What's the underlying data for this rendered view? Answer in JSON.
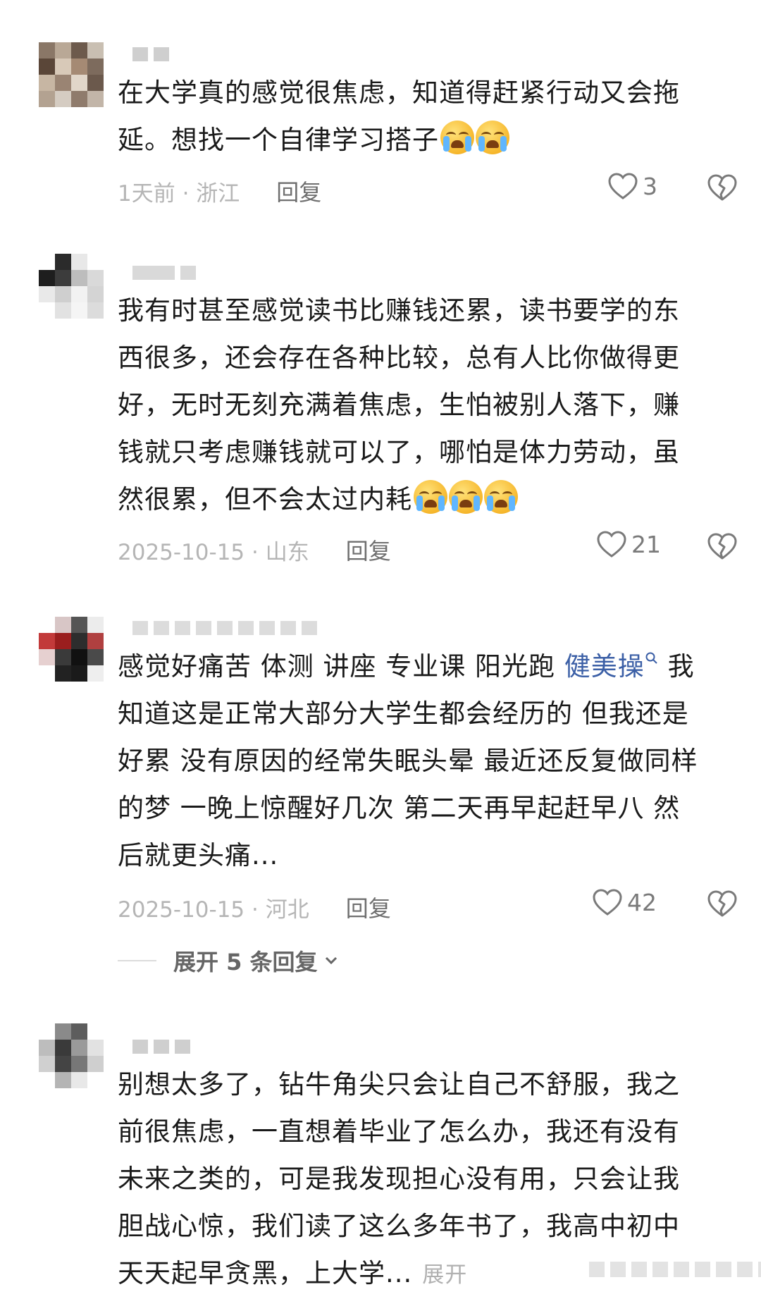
{
  "comments": [
    {
      "text_lines": [
        "在大学真的感觉很焦虑，知道得赶紧行动又会拖",
        "延。想找一个自律学习搭子"
      ],
      "emoji_count": 2,
      "time_location": "1天前 · 浙江",
      "reply_label": "回复",
      "likes": "3"
    },
    {
      "text_lines": [
        "我有时甚至感觉读书比赚钱还累，读书要学的东",
        "西很多，还会存在各种比较，总有人比你做得更",
        "好，无时无刻充满着焦虑，生怕被别人落下，赚",
        "钱就只考虑赚钱就可以了，哪怕是体力劳动，虽",
        "然很累，但不会太过内耗"
      ],
      "emoji_count": 3,
      "time_location": "2025-10-15 · 山东",
      "reply_label": "回复",
      "likes": "21"
    },
    {
      "text_line1_prefix": "感觉好痛苦 体测 讲座 专业课 阳光跑 ",
      "text_line1_link": "健美操",
      "text_line1_suffix": " 我",
      "text_lines": [
        "知道这是正常大部分大学生都会经历的 但我还是",
        "好累 没有原因的经常失眠头晕 最近还反复做同样",
        "的梦 一晚上惊醒好几次 第二天再早起赶早八 然",
        "后就更头痛..."
      ],
      "time_location": "2025-10-15 · 河北",
      "reply_label": "回复",
      "likes": "42",
      "expand_label": "展开 5 条回复"
    },
    {
      "text_lines": [
        "别想太多了，钻牛角尖只会让自己不舒服，我之",
        "前很焦虑，一直想着毕业了怎么办，我还有没有",
        "未来之类的，可是我发现担心没有用，只会让我",
        "胆战心惊，我们读了这么多年书了，我高中初中"
      ],
      "last_line": "天天起早贪黑，上大学...",
      "more_label": "展开"
    }
  ],
  "icons": {
    "like": "heart-outline-icon",
    "dislike": "broken-heart-icon",
    "link_search": "search-icon",
    "expand_chevron": "chevron-down-icon",
    "emoji": "crying-face-emoji"
  },
  "colors": {
    "text": "#1a1a1a",
    "meta": "#b5b5b5",
    "link": "#3b5fa6"
  }
}
